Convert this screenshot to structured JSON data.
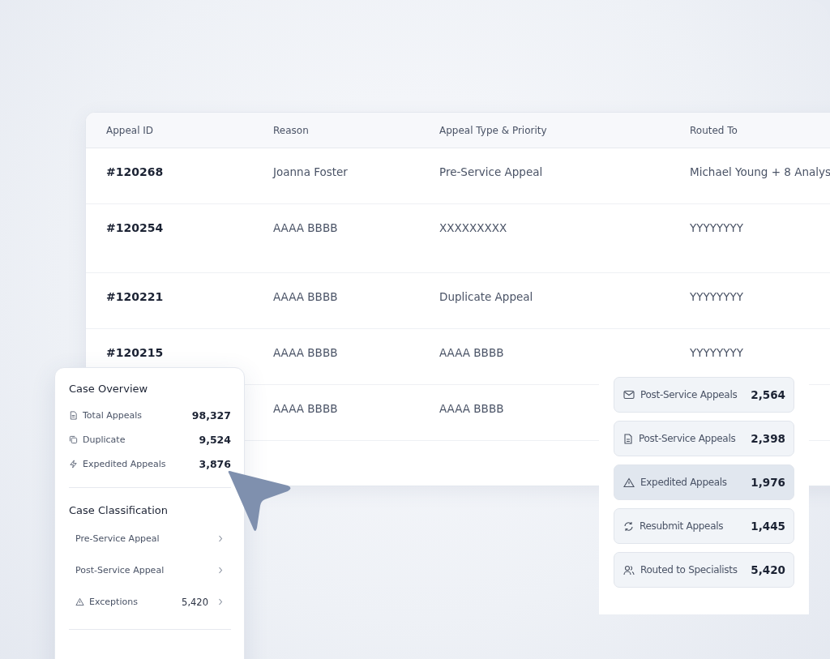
{
  "table": {
    "columns": [
      "Appeal ID",
      "Reason",
      "Appeal Type & Priority",
      "Routed To"
    ],
    "rows": [
      {
        "id": "#120268",
        "reason": "Joanna Foster",
        "type": "Pre-Service Appeal",
        "routed": "Michael Young + 8 Analys"
      },
      {
        "id": "#120254",
        "reason": "AAAA BBBB",
        "type": "XXXXXXXXX",
        "routed": "YYYYYYYY"
      },
      {
        "id": "#120221",
        "reason": "AAAA BBBB",
        "type": "Duplicate Appeal",
        "routed": "YYYYYYYY"
      },
      {
        "id": "#120215",
        "reason": "AAAA BBBB",
        "type": "AAAA BBBB",
        "routed": "YYYYYYYY"
      },
      {
        "reason": "AAAA BBBB",
        "type": "AAAA BBBB"
      }
    ]
  },
  "case_overview": {
    "title": "Case Overview",
    "stats": [
      {
        "label": "Total Appeals",
        "value": "98,327"
      },
      {
        "label": "Duplicate",
        "value": "9,524"
      },
      {
        "label": "Expedited Appeals",
        "value": "3,876"
      }
    ]
  },
  "case_classification": {
    "title": "Case Classification",
    "items": [
      {
        "label": "Pre-Service Appeal"
      },
      {
        "label": "Post-Service Appeal"
      },
      {
        "label": "Exceptions",
        "count": "5,420"
      }
    ]
  },
  "summary": [
    {
      "label": "Post-Service Appeals",
      "value": "2,564",
      "selected": false
    },
    {
      "label": "Post-Service Appeals",
      "value": "2,398",
      "selected": false
    },
    {
      "label": "Expedited Appeals",
      "value": "1,976",
      "selected": true
    },
    {
      "label": "Resubmit Appeals",
      "value": "1,445",
      "selected": false
    },
    {
      "label": "Routed to Specialists",
      "value": "5,420",
      "selected": false
    }
  ]
}
